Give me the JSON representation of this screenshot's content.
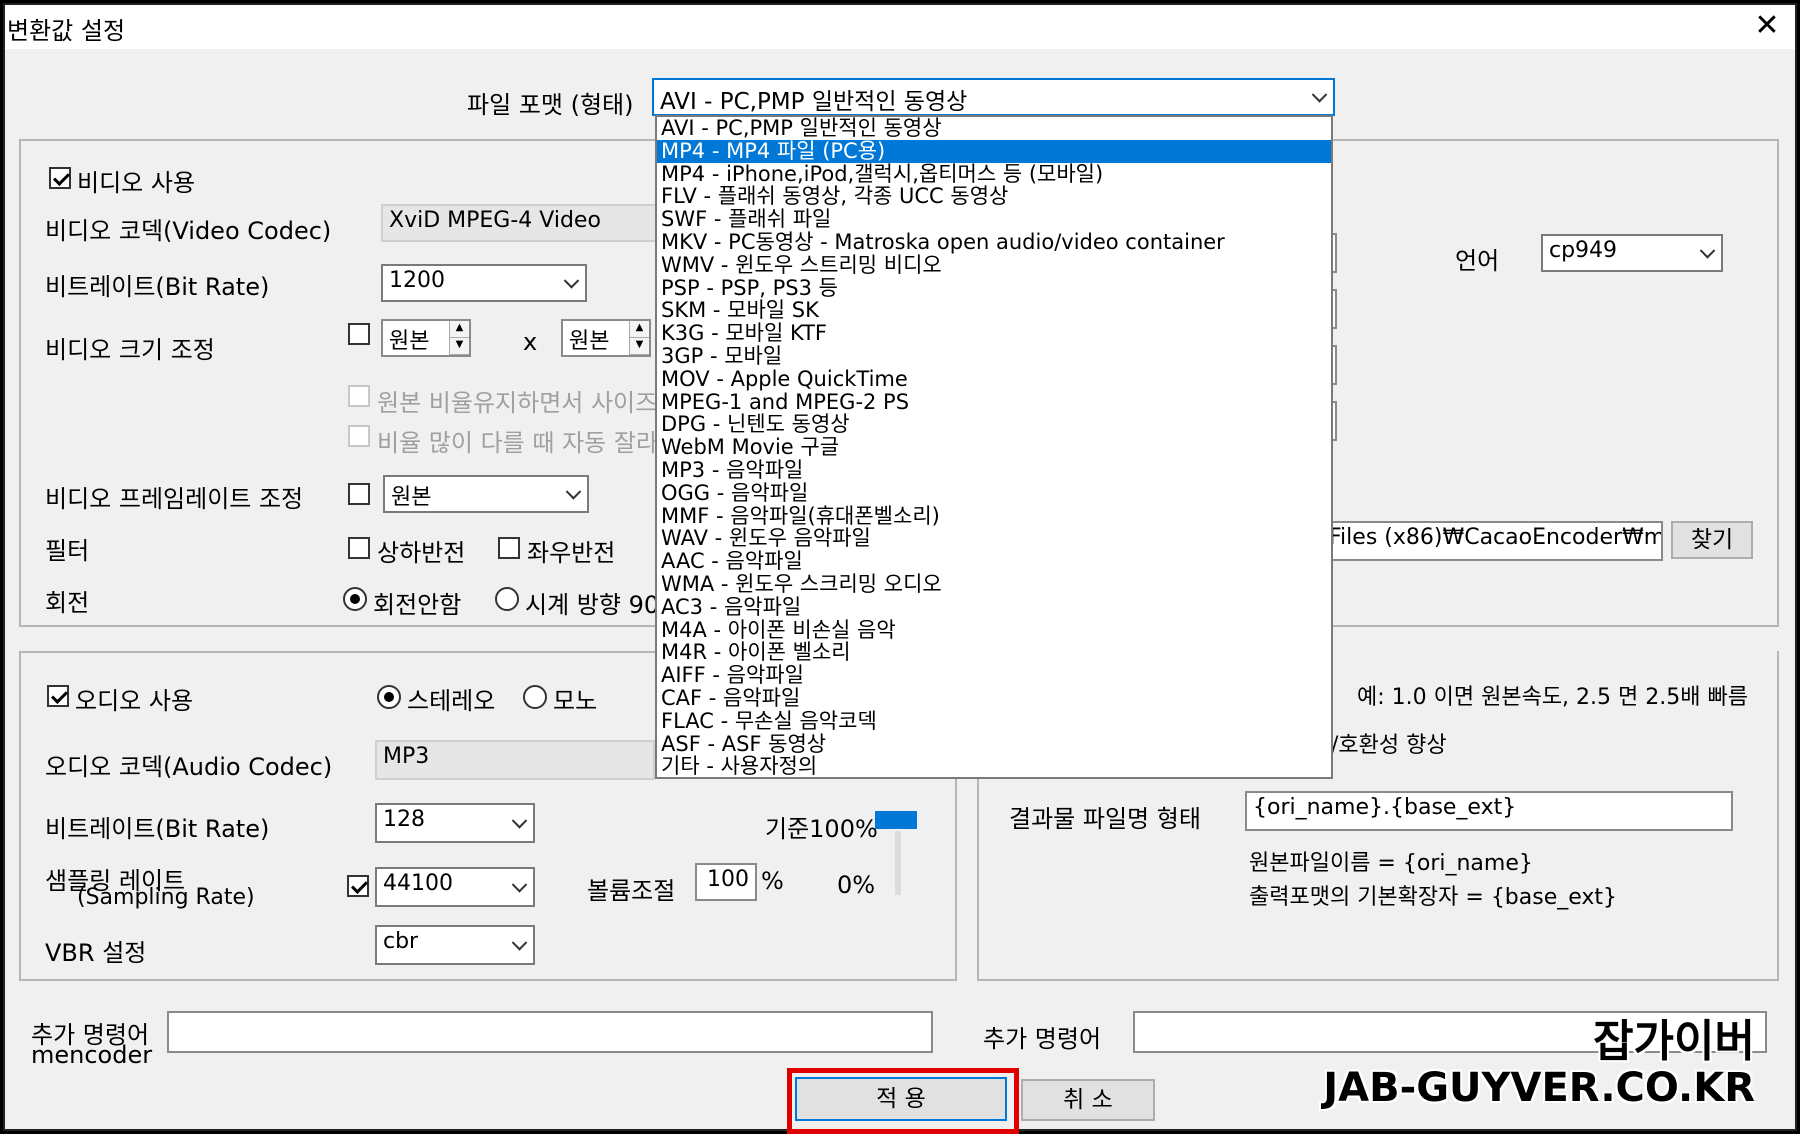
{
  "window": {
    "title": "변환값 설정",
    "close": "✕"
  },
  "format": {
    "label": "파일 포맷 (형태)",
    "selected": "AVI - PC,PMP 일반적인 동영상"
  },
  "format_options": [
    "AVI - PC,PMP 일반적인 동영상",
    "MP4 - MP4 파일 (PC용)",
    "MP4 - iPhone,iPod,갤럭시,옵티머스 등 (모바일)",
    "FLV - 플래쉬 동영상, 각종 UCC 동영상",
    "SWF - 플래쉬 파일",
    "MKV - PC동영상 - Matroska open audio/video container",
    "WMV - 윈도우 스트리밍 비디오",
    "PSP - PSP, PS3 등",
    "SKM - 모바일 SK",
    "K3G - 모바일 KTF",
    "3GP - 모바일",
    "MOV - Apple QuickTime",
    "MPEG-1 and MPEG-2 PS",
    "DPG - 닌텐도 동영상",
    "WebM Movie 구글",
    "MP3 - 음악파일",
    "OGG - 음악파일",
    "MMF - 음악파일(휴대폰벨소리)",
    "WAV - 윈도우 음악파일",
    "AAC - 음악파일",
    "WMA - 윈도우 스크리밍 오디오",
    "AC3 - 음악파일",
    "M4A - 아이폰 비손실 음악",
    "M4R - 아이폰 벨소리",
    "AIFF - 음악파일",
    "CAF - 음악파일",
    "FLAC - 무손실 음악코덱",
    "ASF - ASF 동영상",
    "기타 - 사용자정의"
  ],
  "video": {
    "use_label": "비디오 사용",
    "codec_label": "비디오 코덱(Video Codec)",
    "codec_value": "XviD MPEG-4 Video",
    "bitrate_label": "비트레이트(Bit Rate)",
    "bitrate_value": "1200",
    "resize_label": "비디오 크기 조정",
    "width_value": "원본",
    "x": "x",
    "height_value": "원본",
    "keep_ratio": "원본 비율유지하면서 사이즈",
    "auto_crop": "비율 많이 다를 때 자동 잘라",
    "framerate_label": "비디오 프레임레이트 조정",
    "framerate_value": "원본",
    "filter_label": "필터",
    "flip_v": "상하반전",
    "flip_h": "좌우반전",
    "rotate_label": "회전",
    "rotate_none": "회전안함",
    "rotate_cw": "시계 방향 90"
  },
  "right_top": {
    "lang_label": "언어",
    "lang_value": "cp949",
    "path_value": "Files (x86)₩CacaoEncoder₩m",
    "browse": "찾기"
  },
  "audio": {
    "use_label": "오디오 사용",
    "stereo": "스테레오",
    "mono": "모노",
    "codec_label": "오디오 코덱(Audio Codec)",
    "codec_value": "MP3",
    "bitrate_label": "비트레이트(Bit Rate)",
    "bitrate_value": "128",
    "sampling_label1": "샘플링 레이트",
    "sampling_label2": "(Sampling Rate)",
    "sampling_value": "44100",
    "volume_label": "볼륨조절",
    "volume_value": "100",
    "percent": "%",
    "base": "기준100%",
    "zero": "0%",
    "vbr_label": "VBR 설정",
    "vbr_value": "cbr"
  },
  "right_bottom": {
    "speed_hint": "예: 1.0 이면 원본속도, 2.5 면 2.5배 빠름",
    "compat_hint": "/호환성 향상",
    "output_label": "결과물 파일명 형태",
    "output_value": "{ori_name}.{base_ext}",
    "help1": "원본파일이름 = {ori_name}",
    "help2": "출력포맷의 기본확장자 = {base_ext}"
  },
  "extra": {
    "label1": "추가 명령어",
    "label1b": "mencoder",
    "label2": "추가 명령어"
  },
  "buttons": {
    "apply": "적 용",
    "cancel": "취 소"
  },
  "watermark": {
    "line1": "잡가이버",
    "line2": "JAB-GUYVER.CO.KR"
  },
  "colors": {
    "selection": "#0078d7",
    "highlight": "#e00000"
  }
}
